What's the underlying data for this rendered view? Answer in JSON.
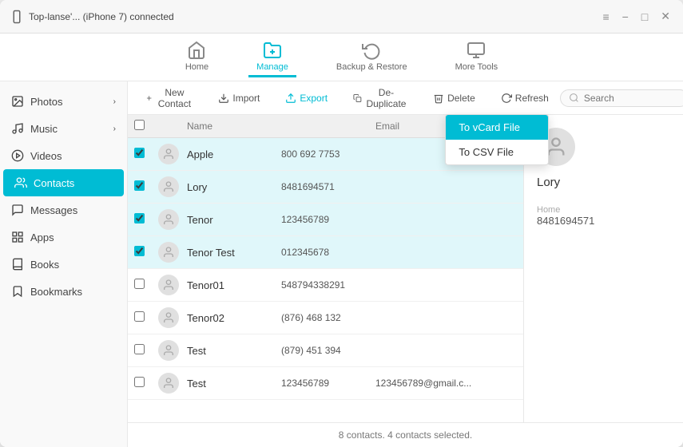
{
  "window": {
    "title": "Top-lanse'... (iPhone 7) connected"
  },
  "titlebar": {
    "device_icon": "phone",
    "device_name": "Top-lanse'... (iPhone 7)",
    "device_status": "connected",
    "menu_icon": "≡",
    "minimize": "−",
    "maximize": "□",
    "close": "✕"
  },
  "nav": {
    "items": [
      {
        "id": "home",
        "label": "Home",
        "active": false
      },
      {
        "id": "manage",
        "label": "Manage",
        "active": true
      },
      {
        "id": "backup",
        "label": "Backup & Restore",
        "active": false
      },
      {
        "id": "tools",
        "label": "More Tools",
        "active": false
      }
    ]
  },
  "sidebar": {
    "items": [
      {
        "id": "photos",
        "label": "Photos",
        "has_arrow": true
      },
      {
        "id": "music",
        "label": "Music",
        "has_arrow": true
      },
      {
        "id": "videos",
        "label": "Videos",
        "has_arrow": false
      },
      {
        "id": "contacts",
        "label": "Contacts",
        "has_arrow": false,
        "active": true
      },
      {
        "id": "messages",
        "label": "Messages",
        "has_arrow": false
      },
      {
        "id": "apps",
        "label": "Apps",
        "has_arrow": false
      },
      {
        "id": "books",
        "label": "Books",
        "has_arrow": false
      },
      {
        "id": "bookmarks",
        "label": "Bookmarks",
        "has_arrow": false
      }
    ]
  },
  "toolbar": {
    "new_contact": "New Contact",
    "import": "Import",
    "export": "Export",
    "deduplicate": "De-Duplicate",
    "delete": "Delete",
    "refresh": "Refresh",
    "search_placeholder": "Search"
  },
  "export_dropdown": {
    "items": [
      {
        "id": "vcard",
        "label": "To vCard File",
        "active": true
      },
      {
        "id": "csv",
        "label": "To CSV File",
        "active": false
      }
    ]
  },
  "table": {
    "headers": {
      "name": "Name",
      "phone": "",
      "email": "Email"
    },
    "rows": [
      {
        "id": 1,
        "name": "Apple",
        "phone": "800 692 7753",
        "email": "",
        "selected": true
      },
      {
        "id": 2,
        "name": "Lory",
        "phone": "8481694571",
        "email": "",
        "selected": true
      },
      {
        "id": 3,
        "name": "Tenor",
        "phone": "123456789",
        "email": "",
        "selected": true
      },
      {
        "id": 4,
        "name": "Tenor Test",
        "phone": "012345678",
        "email": "",
        "selected": true
      },
      {
        "id": 5,
        "name": "Tenor01",
        "phone": "548794338291",
        "email": "",
        "selected": false
      },
      {
        "id": 6,
        "name": "Tenor02",
        "phone": "(876) 468 132",
        "email": "",
        "selected": false
      },
      {
        "id": 7,
        "name": "Test",
        "phone": "(879) 451 394",
        "email": "",
        "selected": false
      },
      {
        "id": 8,
        "name": "Test",
        "phone": "123456789",
        "email": "123456789@gmail.c...",
        "selected": false
      }
    ]
  },
  "detail": {
    "name": "Lory",
    "phone_label": "Home",
    "phone": "8481694571"
  },
  "status": {
    "text": "8 contacts. 4 contacts selected."
  }
}
